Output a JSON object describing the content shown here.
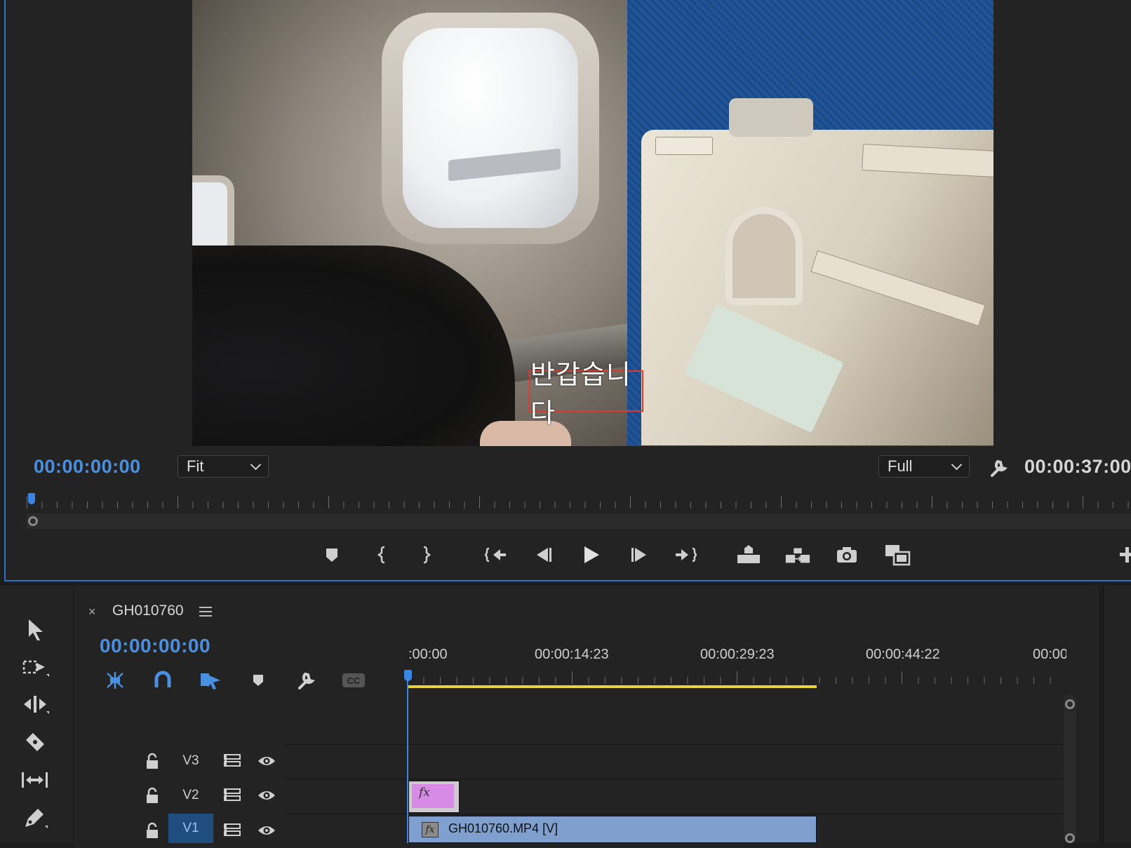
{
  "monitor": {
    "caption": "반갑습니다",
    "current_timecode": "00:00:00:00",
    "zoom_select": "Fit",
    "resolution_select": "Full",
    "duration_timecode": "00:00:37:00"
  },
  "transport": {
    "buttons": [
      "add-marker",
      "mark-in",
      "mark-out",
      "go-to-in",
      "step-back",
      "play",
      "step-forward",
      "go-to-out",
      "lift",
      "extract",
      "export-frame",
      "comparison-view",
      "add-button"
    ]
  },
  "timeline": {
    "sequence_name": "GH010760",
    "timecode": "00:00:00:00",
    "ruler_labels": [
      ":00:00",
      "00:00:14:23",
      "00:00:29:23",
      "00:00:44:22",
      "00:00:"
    ],
    "tracks": [
      {
        "name": "V3",
        "selected": false
      },
      {
        "name": "V2",
        "selected": false
      },
      {
        "name": "V1",
        "selected": true
      }
    ],
    "clips": {
      "v2_fx_badge": "fx",
      "v1_fx_badge": "fx",
      "v1_clip_name": "GH010760.MP4 [V]"
    }
  },
  "colors": {
    "accent": "#4a90e2",
    "workarea": "#e8d33a",
    "clip_video": "#7f9fcf",
    "clip_graphic": "#d88be6",
    "caption_box": "#e03b2f"
  }
}
